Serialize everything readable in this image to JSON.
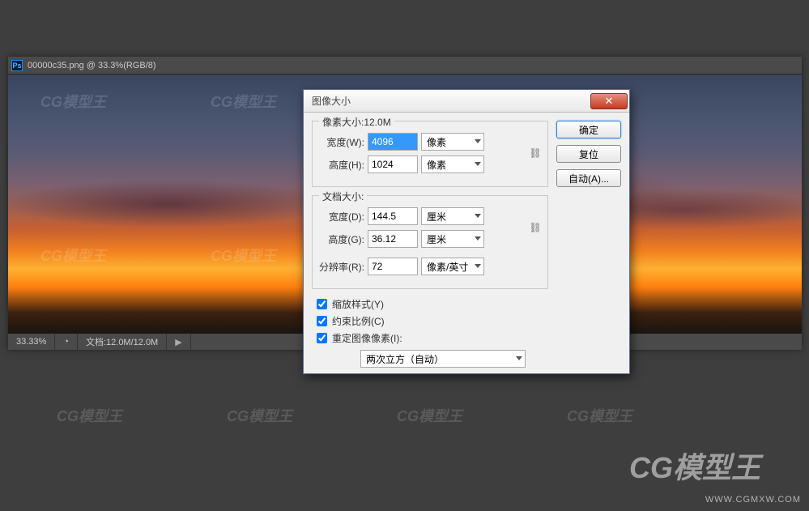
{
  "tab_title": "00000c35.png @ 33.3%(RGB/8)",
  "ps_icon": "Ps",
  "status": {
    "zoom": "33.33%",
    "doc": "文档:12.0M/12.0M"
  },
  "dialog": {
    "title": "图像大小",
    "close_glyph": "✕",
    "pixel_dim": {
      "legend": "像素大小:12.0M",
      "width_label": "宽度(W):",
      "width_value": "4096",
      "height_label": "高度(H):",
      "height_value": "1024",
      "unit": "像素"
    },
    "doc_dim": {
      "legend": "文档大小:",
      "width_label": "宽度(D):",
      "width_value": "144.5",
      "height_label": "高度(G):",
      "height_value": "36.12",
      "unit": "厘米",
      "res_label": "分辨率(R):",
      "res_value": "72",
      "res_unit": "像素/英寸"
    },
    "checks": {
      "scale_styles": "缩放样式(Y)",
      "constrain": "约束比例(C)",
      "resample": "重定图像像素(I):"
    },
    "resample_method": "两次立方（自动）",
    "buttons": {
      "ok": "确定",
      "reset": "复位",
      "auto": "自动(A)..."
    },
    "link_glyph": "⛓"
  },
  "watermark": {
    "text": "CG模型王",
    "url": "WWW.CGMXW.COM"
  }
}
